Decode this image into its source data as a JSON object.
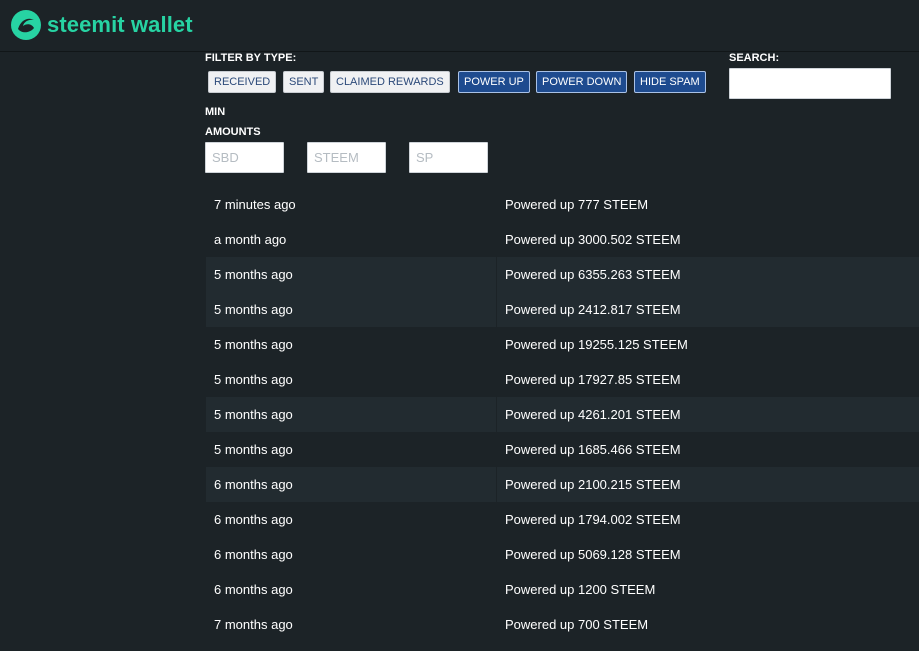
{
  "brand": {
    "name": "steemit wallet",
    "color": "#27d3a3"
  },
  "filters": {
    "title": "FILTER BY TYPE:",
    "buttons": [
      {
        "label": "RECEIVED",
        "active": false
      },
      {
        "label": "SENT",
        "active": false
      },
      {
        "label": "CLAIMED REWARDS",
        "active": false
      },
      {
        "label": "POWER UP",
        "active": true
      },
      {
        "label": "POWER DOWN",
        "active": true
      },
      {
        "label": "HIDE SPAM",
        "active": true
      }
    ]
  },
  "search": {
    "label": "SEARCH:",
    "value": ""
  },
  "min_amounts": {
    "label_line1": "MIN",
    "label_line2": "AMOUNTS",
    "fields": [
      {
        "placeholder": "SBD"
      },
      {
        "placeholder": "STEEM"
      },
      {
        "placeholder": "SP"
      }
    ]
  },
  "transactions": [
    {
      "time": "7 minutes ago",
      "desc": "Powered up 777 STEEM"
    },
    {
      "time": "a month ago",
      "desc": "Powered up 3000.502 STEEM"
    },
    {
      "time": "5 months ago",
      "desc": "Powered up 6355.263 STEEM"
    },
    {
      "time": "5 months ago",
      "desc": "Powered up 2412.817 STEEM"
    },
    {
      "time": "5 months ago",
      "desc": "Powered up 19255.125 STEEM"
    },
    {
      "time": "5 months ago",
      "desc": "Powered up 17927.85 STEEM"
    },
    {
      "time": "5 months ago",
      "desc": "Powered up 4261.201 STEEM"
    },
    {
      "time": "5 months ago",
      "desc": "Powered up 1685.466 STEEM"
    },
    {
      "time": "6 months ago",
      "desc": "Powered up 2100.215 STEEM"
    },
    {
      "time": "6 months ago",
      "desc": "Powered up 1794.002 STEEM"
    },
    {
      "time": "6 months ago",
      "desc": "Powered up 5069.128 STEEM"
    },
    {
      "time": "6 months ago",
      "desc": "Powered up 1200 STEEM"
    },
    {
      "time": "7 months ago",
      "desc": "Powered up 700 STEEM"
    }
  ]
}
